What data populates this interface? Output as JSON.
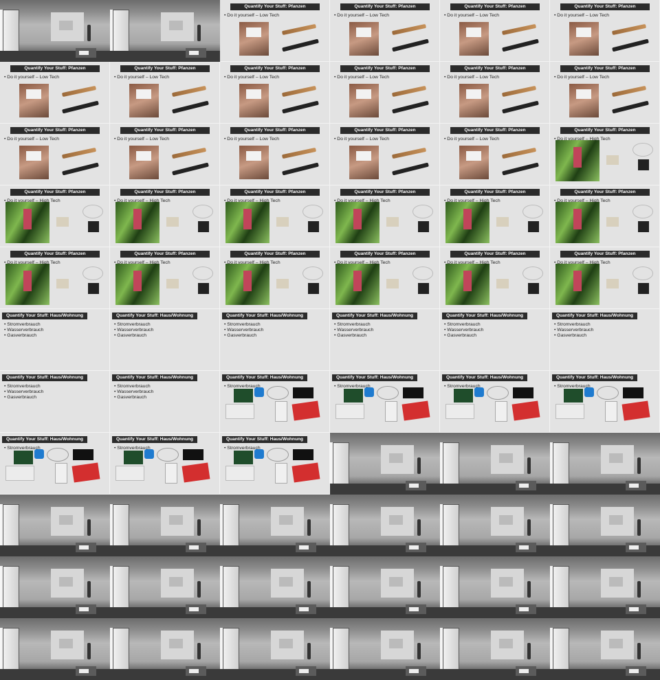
{
  "grid": {
    "columns": 6,
    "rows": 11
  },
  "slides": {
    "pflanzen": {
      "title": "Quantify Your Stuff: Pfanzen",
      "low_tech": "Do it yourself – Low Tech",
      "high_tech": "Do it yourself – High Tech"
    },
    "haus": {
      "title": "Quantify Your Stuff: Haus/Wohnung",
      "items": [
        "Stromverbrauch",
        "Wasserverbrauch",
        "Gasverbrauch"
      ],
      "strom_only": [
        "Stromverbrauch"
      ]
    }
  },
  "tiles": [
    "photo",
    "photo",
    "low",
    "low",
    "low",
    "low",
    "low",
    "low",
    "low",
    "low",
    "low",
    "low",
    "low",
    "low",
    "low",
    "low",
    "low",
    "high",
    "high",
    "high",
    "high",
    "high",
    "high",
    "high",
    "high",
    "high",
    "high",
    "high",
    "high",
    "high",
    "haus",
    "haus",
    "haus",
    "haus",
    "haus",
    "haus",
    "haus",
    "haus",
    "strom",
    "strom",
    "strom",
    "strom",
    "strom",
    "strom",
    "strom",
    "photo",
    "photo",
    "photo",
    "photo",
    "photo",
    "photo",
    "photo",
    "photo",
    "photo",
    "photo",
    "photo",
    "photo",
    "photo",
    "photo",
    "photo",
    "photo",
    "photo",
    "photo",
    "photo",
    "photo",
    "photo"
  ]
}
